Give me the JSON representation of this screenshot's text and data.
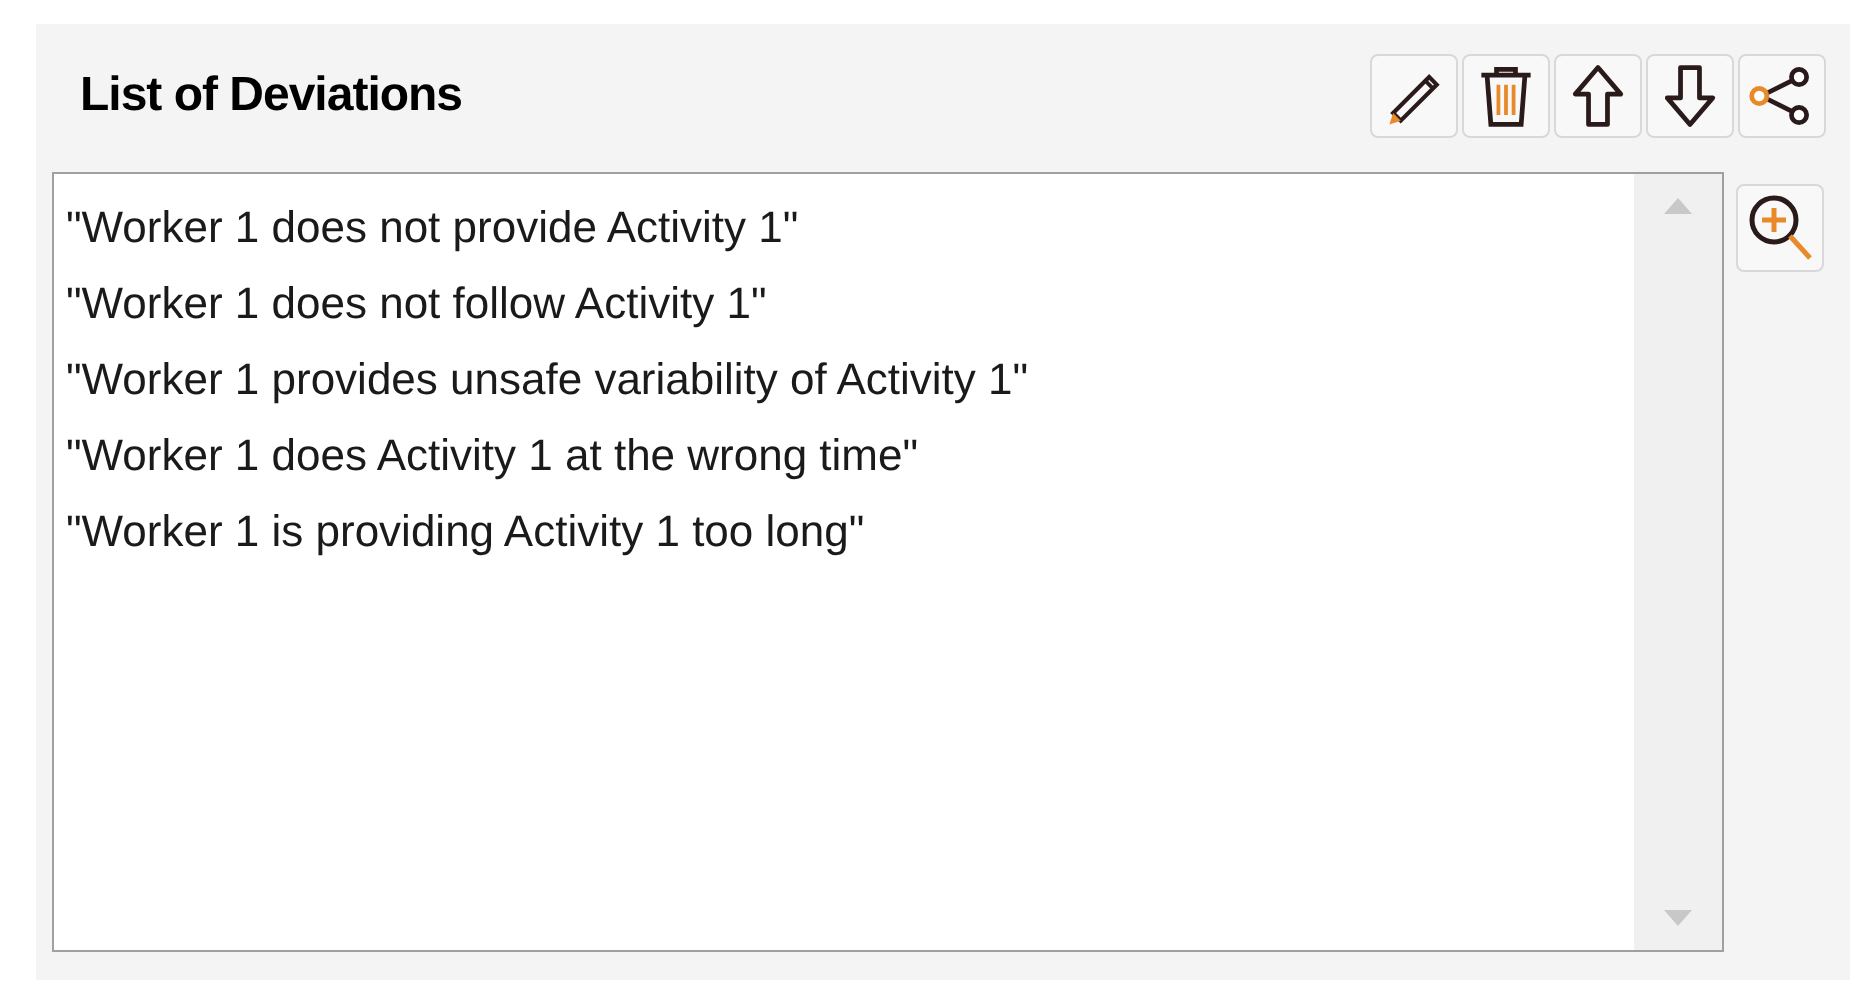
{
  "title": "List of Deviations",
  "toolbar": [
    {
      "kind": "edit"
    },
    {
      "kind": "delete"
    },
    {
      "kind": "up"
    },
    {
      "kind": "down"
    },
    {
      "kind": "share"
    }
  ],
  "deviations": [
    "\"Worker 1 does not provide Activity 1\"",
    "\"Worker 1 does not follow Activity 1\"",
    "\"Worker 1 provides unsafe variability of Activity 1\"",
    "\"Worker 1 does Activity 1 at the wrong time\"",
    "\"Worker 1 is providing Activity 1 too long\""
  ]
}
